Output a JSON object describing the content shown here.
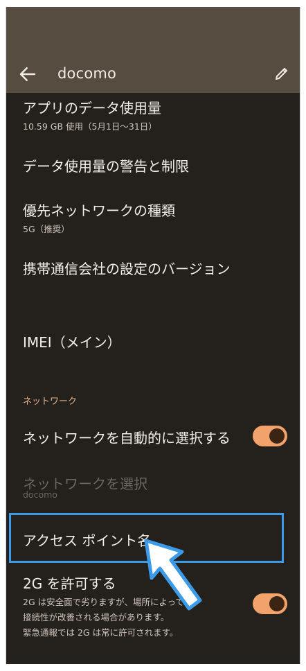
{
  "header": {
    "title": "docomo",
    "back_icon": "arrow-left-icon",
    "edit_icon": "pencil-icon"
  },
  "items": [
    {
      "title": "アプリのデータ使用量",
      "subtitle": "10.59 GB 使用（5月1日〜31日）"
    },
    {
      "title": "データ使用量の警告と制限"
    },
    {
      "title": "優先ネットワークの種類",
      "subtitle": "5G（推奨）"
    },
    {
      "title": "携帯通信会社の設定のバージョン"
    },
    {
      "title": "IMEI（メイン）"
    }
  ],
  "section_network": "ネットワーク",
  "auto_select": {
    "title": "ネットワークを自動的に選択する",
    "toggle_on": true
  },
  "select_network": {
    "title": "ネットワークを選択",
    "subtitle": "docomo"
  },
  "apn": {
    "title": "アクセス ポイント名"
  },
  "allow_2g": {
    "title": "2G を許可する",
    "desc_line1": "2G は安全面で劣りますが、場所によっては",
    "desc_line2": "接続性が改善される場合があります。",
    "desc_line3": "緊急通報では 2G は常に許可されます。",
    "toggle_on": true
  },
  "colors": {
    "header": "#574c40",
    "background": "#24201c",
    "accent": "#f2a36c",
    "highlight": "#3c9be8"
  }
}
